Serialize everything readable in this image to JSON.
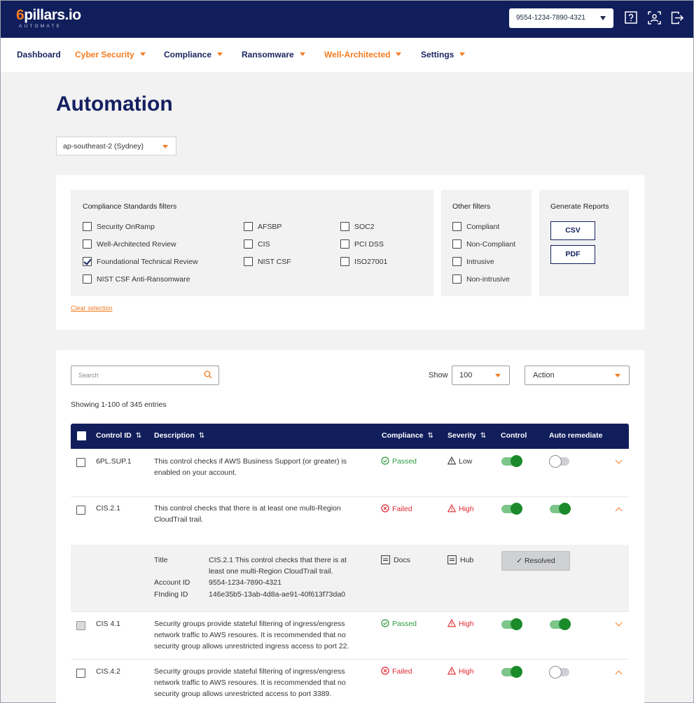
{
  "header": {
    "logo_text": "6pillars.io",
    "logo_sub": "AUTOMATE",
    "account_id": "9554-1234-7890-4321",
    "icons": [
      "help-icon",
      "profile-scan-icon",
      "logout-icon"
    ]
  },
  "nav": {
    "items": [
      {
        "label": "Dashboard",
        "has_caret": false,
        "active": false
      },
      {
        "label": "Cyber Security",
        "has_caret": true,
        "active": true
      },
      {
        "label": "Compliance",
        "has_caret": true,
        "active": false
      },
      {
        "label": "Ransomware",
        "has_caret": true,
        "active": false
      },
      {
        "label": "Well-Architected",
        "has_caret": true,
        "active": true
      },
      {
        "label": "Settings",
        "has_caret": true,
        "active": false
      }
    ]
  },
  "page": {
    "title": "Automation",
    "region": "ap-southeast-2 (Sydney)"
  },
  "filters": {
    "compliance_title": "Compliance Standards filters",
    "compliance_options": [
      {
        "label": "Security OnRamp",
        "checked": false
      },
      {
        "label": "Well-Architected Review",
        "checked": false
      },
      {
        "label": "Foundational Technical Review",
        "checked": true
      },
      {
        "label": "NIST CSF Anti-Ransomware",
        "checked": false
      },
      {
        "label": "AFSBP",
        "checked": false
      },
      {
        "label": "CIS",
        "checked": false
      },
      {
        "label": "NIST CSF",
        "checked": false
      },
      {
        "label": "SOC2",
        "checked": false
      },
      {
        "label": "PCI DSS",
        "checked": false
      },
      {
        "label": "ISO27001",
        "checked": false
      }
    ],
    "other_title": "Other filters",
    "other_options": [
      {
        "label": "Compliant",
        "checked": false
      },
      {
        "label": "Non-Compliant",
        "checked": false
      },
      {
        "label": "Intrusive",
        "checked": false
      },
      {
        "label": "Non-intrusive",
        "checked": false
      }
    ],
    "reports_title": "Generate Reports",
    "report_buttons": [
      "CSV",
      "PDF"
    ],
    "clear_label": "Clear selection"
  },
  "table": {
    "search_placeholder": "Search",
    "show_label": "Show",
    "show_value": "100",
    "action_label": "Action",
    "entries_text": "Showing 1-100 of 345 entries",
    "columns": [
      "Control ID",
      "Description",
      "Compliance",
      "Severity",
      "Control",
      "Auto remediate"
    ],
    "rows": [
      {
        "control_id": "6PL.SUP.1",
        "desc_lines": [
          "This control checks if AWS Business Support (or greater) is",
          "enabled on your account."
        ],
        "compliance": "Passed",
        "severity": "Low",
        "control_on": true,
        "auto_on": false,
        "expanded": false
      },
      {
        "control_id": "CIS.2.1",
        "desc_lines": [
          "This control checks that there is at least one multi-Region",
          "CloudTrail trail."
        ],
        "compliance": "Failed",
        "severity": "High",
        "control_on": true,
        "auto_on": true,
        "expanded": true
      },
      {
        "control_id": "CIS 4.1",
        "desc_lines": [
          "Security groups provide stateful filtering of ingress/engress",
          "network traffic to AWS resoures. It is recommended that no",
          "security group allows unrestricted ingress access to port 22."
        ],
        "compliance": "Passed",
        "severity": "High",
        "control_on": true,
        "auto_on": true,
        "expanded": false
      },
      {
        "control_id": "CIS.4.2",
        "desc_lines": [
          "Security groups provide stateful filtering of ingress/engress",
          "network traffic to AWS resoures. It is recommended that no",
          "security group allows unrestricted access to port 3389."
        ],
        "compliance": "Failed",
        "severity": "High",
        "control_on": true,
        "auto_on": false,
        "expanded": false
      }
    ],
    "detail": {
      "title_label": "Title",
      "title_lines": [
        "CIS.2.1 This control checks that there is at",
        "least one multi-Region CloudTrail trail."
      ],
      "account_label": "Account ID",
      "account_value": "9554-1234-7890-4321",
      "finding_label": "FInding ID",
      "finding_value": "146e35b5-13ab-4d8a-ae91-40f613f73da0",
      "docs_label": "Docs",
      "hub_label": "Hub",
      "resolved_label": "Resolved",
      "resolved_mark": "✓"
    }
  },
  "colors": {
    "navy": "#111e5c",
    "orange": "#f47b20",
    "pass_green": "#2e9a3e",
    "fail_red": "#e0282f",
    "toggle_green": "#1b8a2a"
  }
}
